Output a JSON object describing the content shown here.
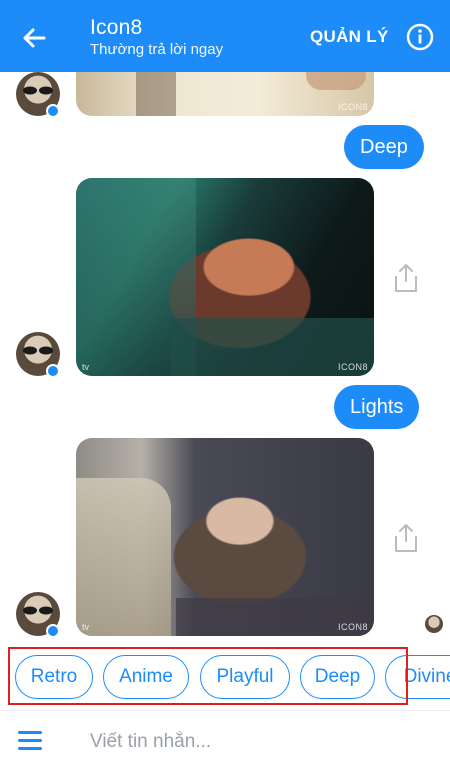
{
  "header": {
    "title": "Icon8",
    "subtitle": "Thường trả lời ngay",
    "manage_label": "QUẢN LÝ",
    "back_icon": "back-arrow-icon",
    "info_icon": "info-icon"
  },
  "messages": {
    "sent": [
      "Deep",
      "Lights"
    ],
    "watermark": "ICON8",
    "watermark_small": "tv"
  },
  "quick_replies": [
    "Retro",
    "Anime",
    "Playful",
    "Deep",
    "Divine"
  ],
  "composer": {
    "placeholder": "Viết tin nhắn...",
    "menu_icon": "hamburger-menu-icon"
  },
  "colors": {
    "accent": "#1d8cf8",
    "highlight_border": "#e02020"
  }
}
